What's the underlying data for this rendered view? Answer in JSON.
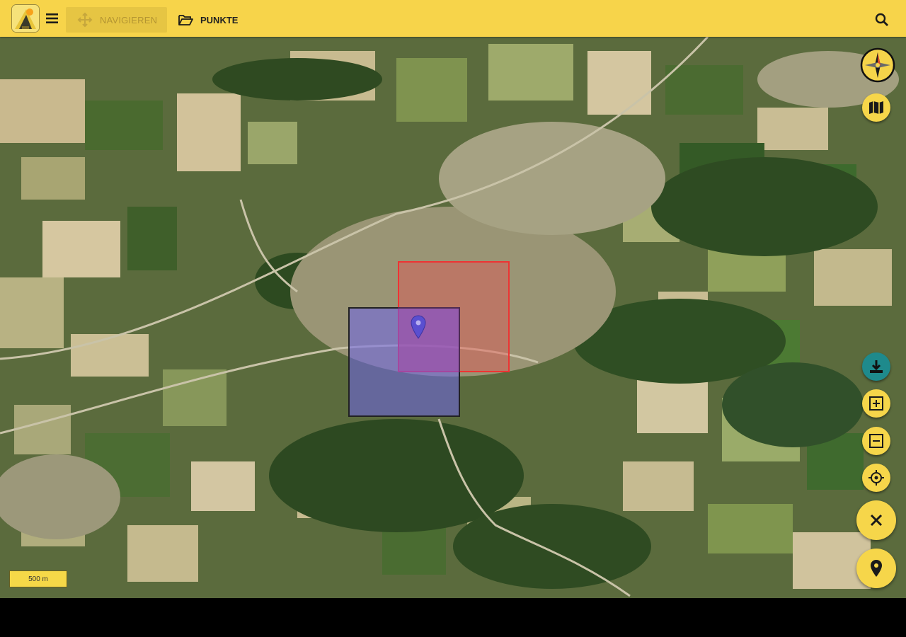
{
  "toolbar": {
    "navigate_label": "NAVIGIEREN",
    "points_label": "PUNKTE"
  },
  "icons": {
    "logo": "app-logo-icon",
    "menu": "hamburger-menu-icon",
    "navigate": "move-arrows-icon",
    "points": "folder-open-icon",
    "search": "search-icon",
    "compass": "compass-icon",
    "layers": "map-icon",
    "download": "download-icon",
    "add_area": "add-area-icon",
    "remove_area": "remove-area-icon",
    "locate": "crosshair-icon",
    "close": "close-icon",
    "marker": "location-pin-icon"
  },
  "map": {
    "scale_label": "500 m"
  },
  "colors": {
    "accent": "#f7d44a",
    "teal": "#1e8a8c",
    "area_red": "#e33333",
    "area_blue": "#6e64eb",
    "marker": "#5a4fd0"
  }
}
